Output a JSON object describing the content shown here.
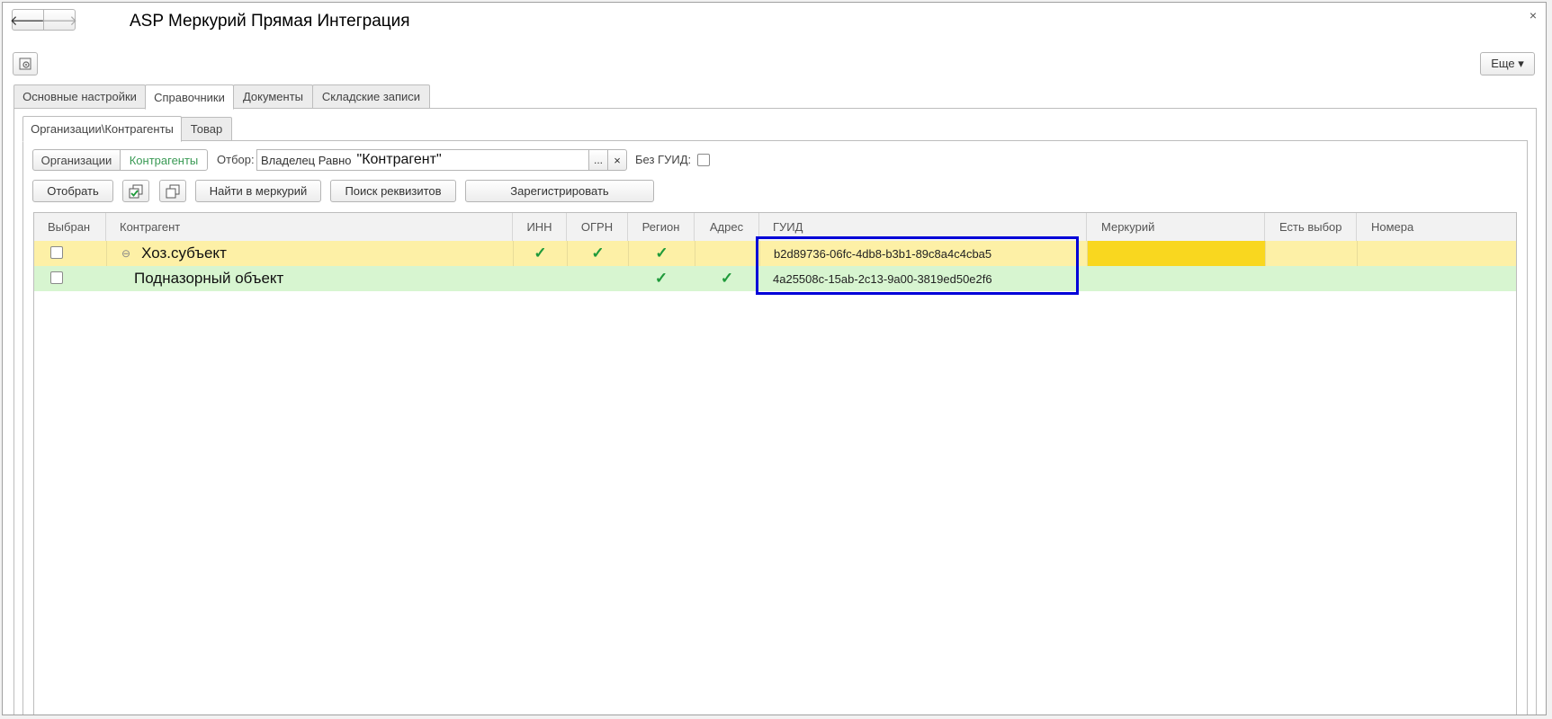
{
  "window": {
    "title": "ASP Меркурий Прямая Интеграция",
    "close_glyph": "×",
    "back_glyph": "🡐",
    "forward_glyph": "🡒",
    "more_label": "Еще ▾"
  },
  "main_tabs": [
    {
      "label": "Основные настройки"
    },
    {
      "label": "Справочники"
    },
    {
      "label": "Документы"
    },
    {
      "label": "Складские записи"
    }
  ],
  "sub_tabs": [
    {
      "label": "Организации\\Контрагенты"
    },
    {
      "label": "Товар"
    }
  ],
  "filter": {
    "seg_org": "Организации",
    "seg_contr": "Контрагенты",
    "filter_label": "Отбор:",
    "filter_prefix": "Владелец Равно",
    "filter_value": "\"Контрагент\"",
    "dots": "...",
    "clear": "×",
    "no_guid_label": "Без ГУИД:"
  },
  "toolbar": {
    "select_label": "Отобрать",
    "find_label": "Найти в меркурий",
    "search_label": "Поиск реквизитов",
    "register_label": "Зарегистрировать"
  },
  "columns": [
    {
      "label": "Выбран"
    },
    {
      "label": "Контрагент"
    },
    {
      "label": "ИНН"
    },
    {
      "label": "ОГРН"
    },
    {
      "label": "Регион"
    },
    {
      "label": "Адрес"
    },
    {
      "label": "ГУИД"
    },
    {
      "label": "Меркурий"
    },
    {
      "label": "Есть выбор"
    },
    {
      "label": "Номера"
    }
  ],
  "rows": [
    {
      "name": "Хоз.субъект",
      "expander": "⊖",
      "inn": "✓",
      "ogrn": "✓",
      "region": "✓",
      "address": "",
      "guid": "b2d89736-06fc-4db8-b3b1-89c8a4c4cba5"
    },
    {
      "name": "Подназорный объект",
      "inn": "",
      "ogrn": "",
      "region": "✓",
      "address": "✓",
      "guid": "4a25508c-15ab-2c13-9a00-3819ed50e2f6"
    }
  ],
  "colors": {
    "row1_bg": "#fdf0a6",
    "row2_bg": "#d7f5d0",
    "mercury_fill": "#f9d71f",
    "active_seg": "#3a9a55",
    "highlight_box": "#0000d8"
  }
}
